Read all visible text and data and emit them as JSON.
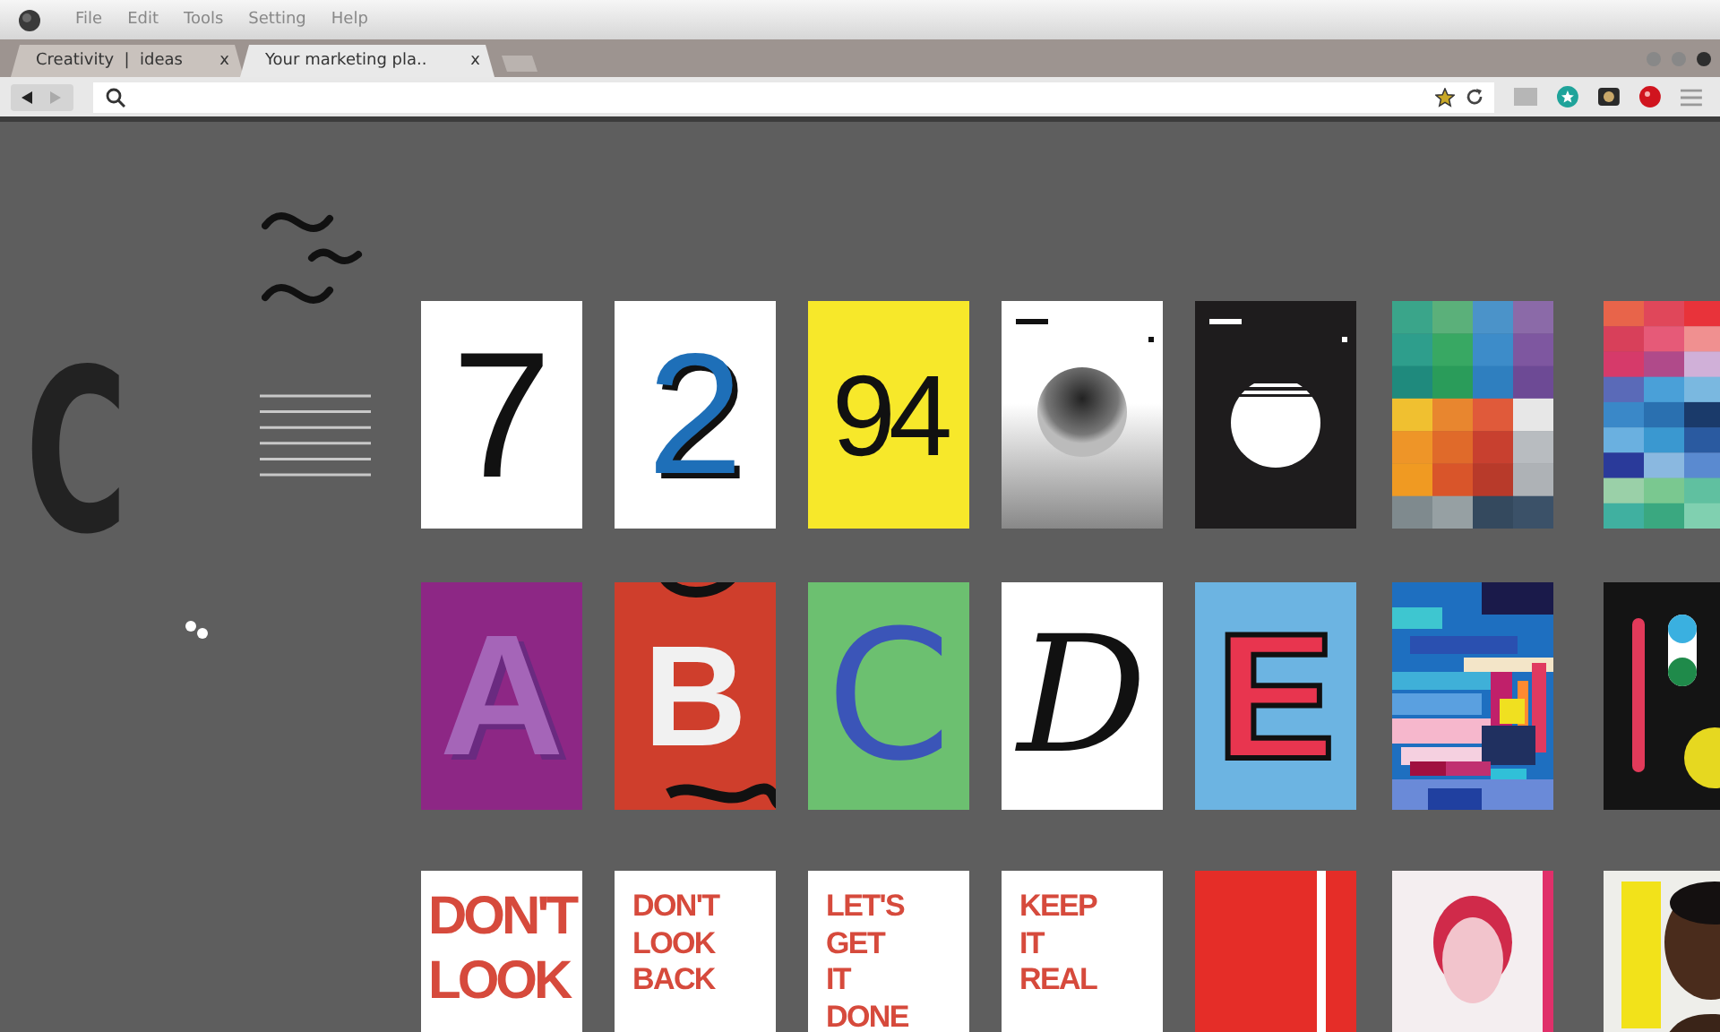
{
  "menu": [
    "File",
    "Edit",
    "Tools",
    "Setting",
    "Help"
  ],
  "tabs": [
    {
      "title": "Creativity  |  ideas",
      "close": "x",
      "selected": false
    },
    {
      "title": "Your marketing pla..",
      "close": "x",
      "selected": true
    }
  ],
  "page": {
    "logo_letter": "C",
    "rows": [
      {
        "posters": [
          {
            "kind": "glyph",
            "text": "7"
          },
          {
            "kind": "glyph",
            "text": "2"
          },
          {
            "kind": "glyph",
            "text": "94"
          },
          {
            "kind": "halftone-sun"
          },
          {
            "kind": "striped-sun"
          },
          {
            "kind": "swatch-grid"
          },
          {
            "kind": "swatch-grid"
          }
        ]
      },
      {
        "posters": [
          {
            "kind": "glyph",
            "text": "A"
          },
          {
            "kind": "glyph",
            "text": "B"
          },
          {
            "kind": "glyph",
            "text": "C"
          },
          {
            "kind": "glyph",
            "text": "D"
          },
          {
            "kind": "glyph",
            "text": "E"
          },
          {
            "kind": "mosaic"
          },
          {
            "kind": "pills"
          }
        ]
      },
      {
        "posters": [
          {
            "kind": "words",
            "text": "DON'T\nLOOK"
          },
          {
            "kind": "words",
            "text": "DON'T\nLOOK\nBACK"
          },
          {
            "kind": "words",
            "text": "LET'S\nGET\nIT\nDONE"
          },
          {
            "kind": "words",
            "text": "KEEP\nIT\nREAL"
          },
          {
            "kind": "stripes"
          },
          {
            "kind": "picture"
          },
          {
            "kind": "picture"
          }
        ]
      }
    ]
  }
}
